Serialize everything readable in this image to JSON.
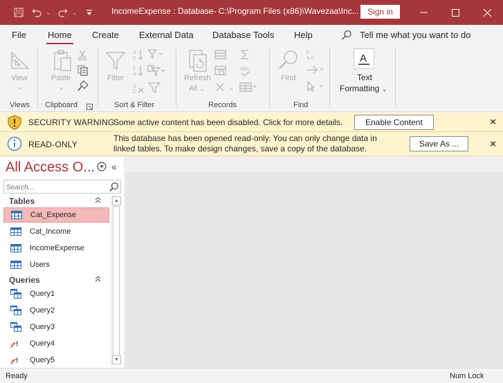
{
  "app": {
    "window_title": "IncomeExpense : Database- C:\\Program Files (x86)\\Wavezaa\\Inc...",
    "sign_in": "Sign in",
    "accent": "#a4373a"
  },
  "menu": {
    "tabs": [
      "File",
      "Home",
      "Create",
      "External Data",
      "Database Tools",
      "Help"
    ],
    "active": "Home",
    "tell_me": "Tell me what you want to do"
  },
  "ribbon": {
    "groups": {
      "views": "Views",
      "clipboard": "Clipboard",
      "sort_filter": "Sort & Filter",
      "records": "Records",
      "find": "Find"
    },
    "buttons": {
      "view": "View",
      "paste": "Paste",
      "filter": "Filter",
      "refresh": "Refresh",
      "refresh_all": "All",
      "find": "Find",
      "text": "Text",
      "formatting": "Formatting"
    }
  },
  "security_bar": {
    "title": "SECURITY WARNING",
    "message": "Some active content has been disabled. Click for more details.",
    "button": "Enable Content",
    "close": "×"
  },
  "readonly_bar": {
    "title": "READ-ONLY",
    "message_line1": "This database has been opened read-only. You can only change data in",
    "message_line2": "linked tables. To make design changes, save a copy of the database.",
    "button": "Save As ...",
    "close": "×"
  },
  "nav": {
    "title": "All Access O...",
    "search_placeholder": "Search...",
    "tables_header": "Tables",
    "tables": [
      "Cat_Expense",
      "Cat_Income",
      "IncomeExpense",
      "Users"
    ],
    "selected_table": "Cat_Expense",
    "queries_header": "Queries",
    "queries": [
      "Query1",
      "Query2",
      "Query3",
      "Query4",
      "Query5"
    ]
  },
  "status": {
    "left": "Ready",
    "right": "Num Lock"
  }
}
